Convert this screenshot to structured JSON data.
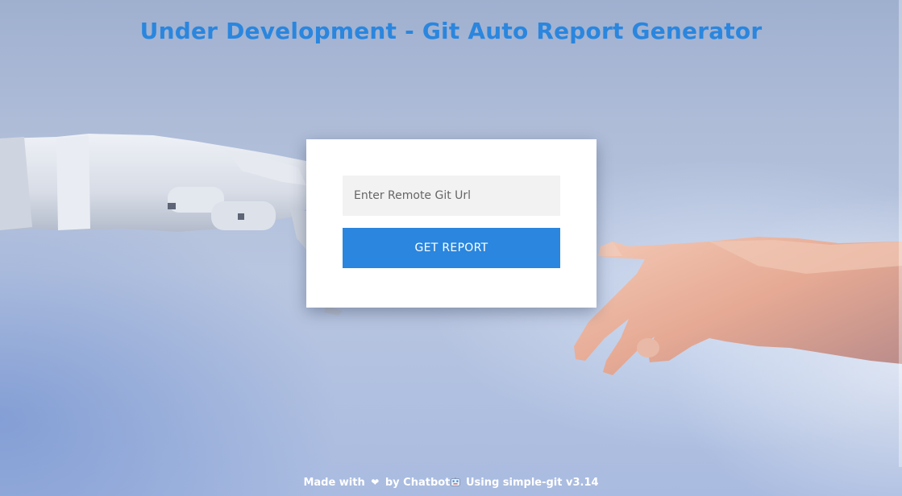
{
  "header": {
    "title": "Under Development - Git Auto Report Generator"
  },
  "form": {
    "url_placeholder": "Enter Remote Git Url",
    "url_value": "",
    "submit_label": "GET REPORT"
  },
  "footer": {
    "made_with": "Made with",
    "heart_icon": "heart-icon",
    "by": "by Chatbot",
    "bot_icon": "robot-face-icon",
    "using": "Using simple-git v3.14"
  },
  "colors": {
    "accent": "#2a86de",
    "card_background": "#ffffff",
    "input_background": "#f2f2f2",
    "footer_text": "#ffffff"
  }
}
